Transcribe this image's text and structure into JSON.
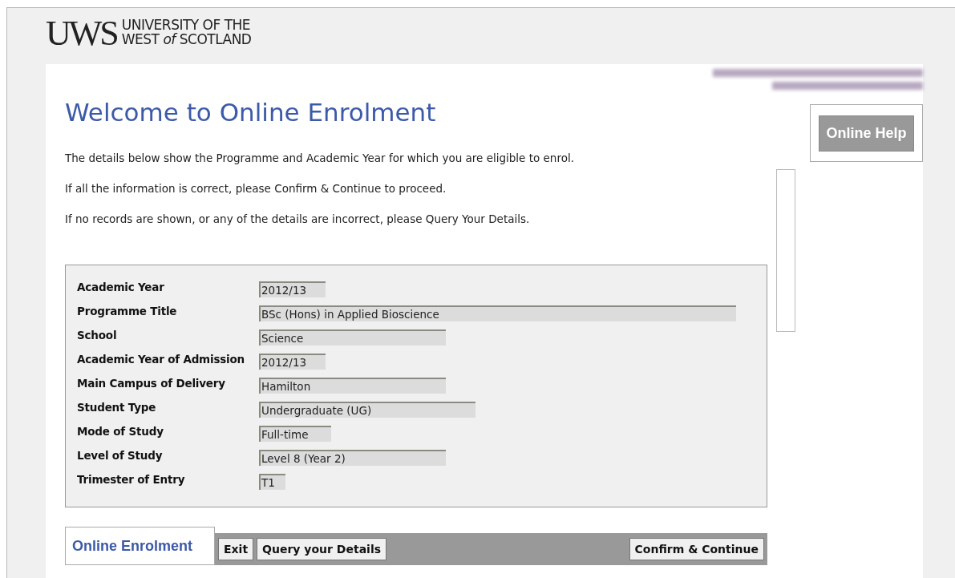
{
  "logo": {
    "mark": "UWS",
    "line_1": "UNIVERSITY OF THE",
    "line_2": "WEST *of* SCOTLAND"
  },
  "heading": "Welcome to Online Enrolment",
  "intro": [
    "The details below show the Programme and Academic Year for which you are eligible to enrol.",
    "If all the information is correct, please Confirm & Continue to proceed.",
    "If no records are shown, or any of the details are incorrect, please Query Your Details."
  ],
  "help_button": "Online Help",
  "details": [
    {
      "label": "Academic Year",
      "value": "2012/13"
    },
    {
      "label": "Programme Title",
      "value": "BSc (Hons) in Applied Bioscience"
    },
    {
      "label": "School",
      "value": "Science"
    },
    {
      "label": "Academic Year of Admission",
      "value": "2012/13"
    },
    {
      "label": "Main Campus of Delivery",
      "value": "Hamilton"
    },
    {
      "label": "Student Type",
      "value": "Undergraduate (UG)"
    },
    {
      "label": "Mode of Study",
      "value": "Full-time"
    },
    {
      "label": "Level of Study",
      "value": "Level 8 (Year 2)"
    },
    {
      "label": "Trimester of Entry",
      "value": "T1"
    }
  ],
  "footer": {
    "tab": "Online Enrolment",
    "left_buttons": [
      "Exit",
      "Query your Details"
    ],
    "right_buttons": [
      "Confirm & Continue"
    ]
  }
}
